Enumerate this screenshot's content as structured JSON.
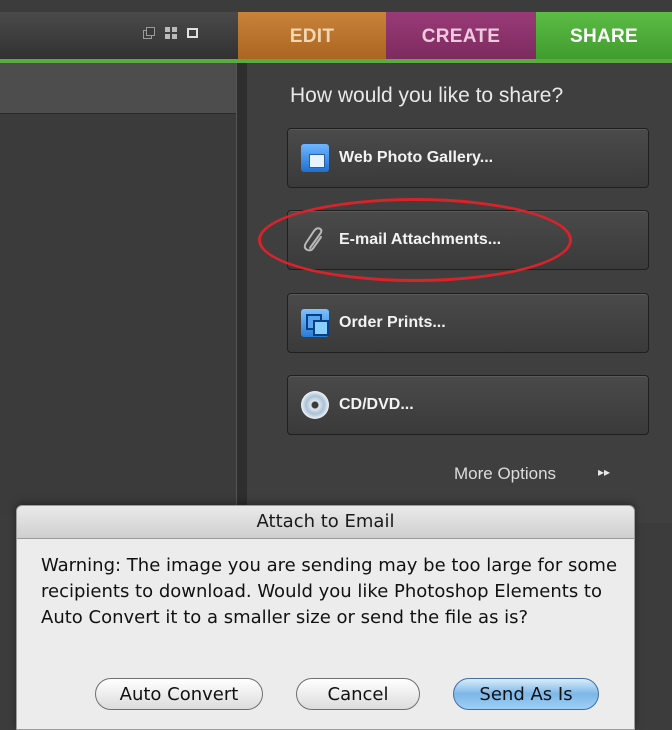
{
  "tabs": [
    {
      "label": "EDIT"
    },
    {
      "label": "CREATE"
    },
    {
      "label": "SHARE"
    }
  ],
  "share_panel": {
    "title": "How would you like to share?",
    "buttons": [
      {
        "label": "Web Photo Gallery...",
        "icon": "web-gallery-icon"
      },
      {
        "label": "E-mail Attachments...",
        "icon": "paperclip-icon"
      },
      {
        "label": "Order Prints...",
        "icon": "prints-icon"
      },
      {
        "label": "CD/DVD...",
        "icon": "disc-icon"
      }
    ],
    "more_options": "More Options",
    "more_arrow": "▸▸"
  },
  "view_icons": [
    "stack-view-icon",
    "grid-view-icon",
    "single-view-icon"
  ],
  "dialog": {
    "title": "Attach to Email",
    "message": "Warning: The image you are sending may be too large for some recipients to download. Would you like Photoshop Elements to Auto Convert it to a smaller size or send the file as is?",
    "buttons": {
      "auto_convert": "Auto Convert",
      "cancel": "Cancel",
      "send_as_is": "Send As Is"
    }
  },
  "colors": {
    "edit_tab": "#b8722d",
    "create_tab": "#8a3169",
    "share_tab": "#4fae38",
    "highlight_ellipse": "#d8232a",
    "default_button": "#7db7e8"
  }
}
